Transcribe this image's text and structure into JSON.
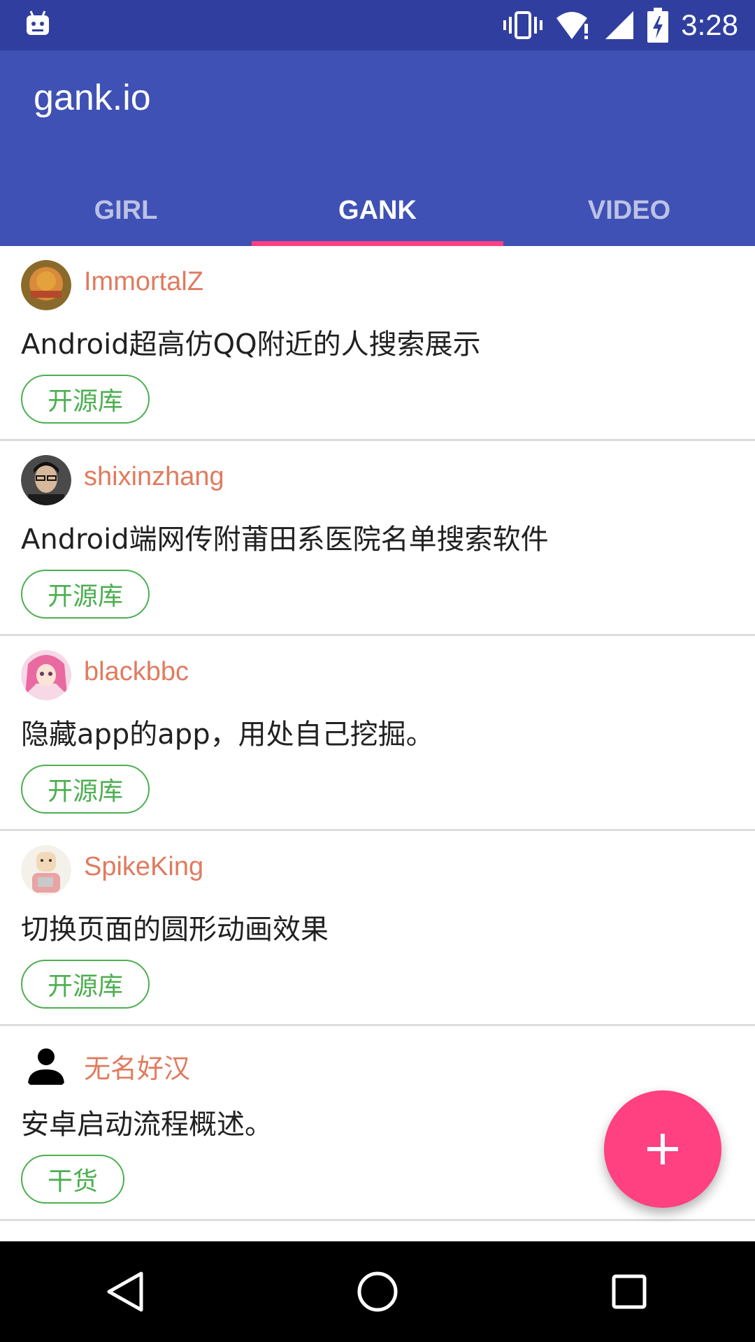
{
  "status_bar": {
    "time": "3:28",
    "icons": [
      "android-icon",
      "vibrate-icon",
      "wifi-alert-icon",
      "signal-icon",
      "battery-charging-icon"
    ]
  },
  "app_bar": {
    "title": "gank.io",
    "tabs": [
      {
        "label": "GIRL",
        "active": false
      },
      {
        "label": "GANK",
        "active": true
      },
      {
        "label": "VIDEO",
        "active": false
      }
    ],
    "indicator_color": "#ff4081"
  },
  "feed": {
    "items": [
      {
        "author": "ImmortalZ",
        "title": "Android超高仿QQ附近的人搜索展示",
        "tag": "开源库"
      },
      {
        "author": "shixinzhang",
        "title": "Android端网传附莆田系医院名单搜索软件",
        "tag": "开源库"
      },
      {
        "author": "blackbbc",
        "title": "隐藏app的app，用处自己挖掘。",
        "tag": "开源库"
      },
      {
        "author": "SpikeKing",
        "title": "切换页面的圆形动画效果",
        "tag": "开源库"
      },
      {
        "author": "无名好汉",
        "title": "安卓启动流程概述。",
        "tag": "干货"
      }
    ]
  },
  "fab": {
    "icon": "plus-icon",
    "color": "#ff4081"
  },
  "nav_bar": {
    "buttons": [
      "back-icon",
      "home-icon",
      "recents-icon"
    ]
  },
  "colors": {
    "primary": "#3f51b5",
    "primary_dark": "#303f9f",
    "author": "#e07b5f",
    "tag": "#4caf50"
  }
}
